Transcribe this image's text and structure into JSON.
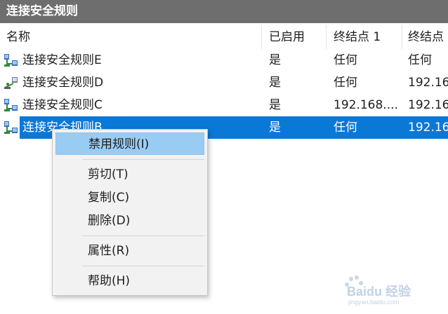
{
  "window": {
    "title": "连接安全规则"
  },
  "columns": {
    "name": "名称",
    "enabled": "已启用",
    "endpoint1": "终结点 1",
    "endpoint2": "终结点"
  },
  "rows": [
    {
      "name": "连接安全规则E",
      "enabled": "是",
      "endpoint1": "任何",
      "endpoint2": "任何",
      "icon": "rule-network-icon"
    },
    {
      "name": "连接安全规则D",
      "enabled": "是",
      "endpoint1": "任何",
      "endpoint2": "192.16",
      "icon": "rule-disabled-network-icon"
    },
    {
      "name": "连接安全规则C",
      "enabled": "是",
      "endpoint1": "192.168....",
      "endpoint2": "192.16",
      "icon": "rule-network-icon"
    },
    {
      "name": "连接安全规则B",
      "enabled": "是",
      "endpoint1": "任何",
      "endpoint2": "192.16",
      "icon": "rule-network-icon",
      "selected": true
    }
  ],
  "context_menu": {
    "items": [
      {
        "label": "禁用规则(I)"
      },
      {
        "label": "剪切(T)"
      },
      {
        "label": "复制(C)"
      },
      {
        "label": "删除(D)"
      },
      {
        "label": "属性(R)"
      },
      {
        "label": "帮助(H)"
      }
    ]
  },
  "colors": {
    "selection": "#0a78d7",
    "menu_hover": "#99ccf3",
    "titlebar": "#6e6e6e"
  },
  "watermark": {
    "brand": "Baidu 经验",
    "url": "jingyan.baidu.com"
  }
}
